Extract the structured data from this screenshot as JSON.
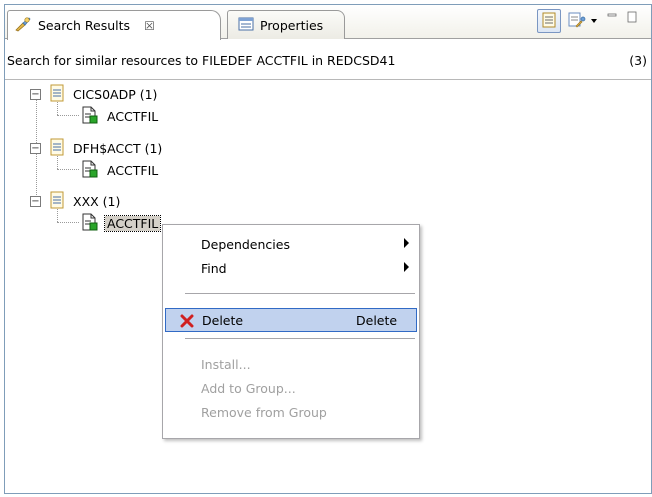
{
  "tabs": [
    {
      "label": "Search Results",
      "close": "☒"
    },
    {
      "label": "Properties"
    }
  ],
  "header": {
    "description": "Search for similar resources to FILEDEF ACCTFIL in REDCSD41",
    "count": "(3)"
  },
  "tree": [
    {
      "group": "CICS0ADP (1)",
      "child": "ACCTFIL"
    },
    {
      "group": "DFH$ACCT (1)",
      "child": "ACCTFIL"
    },
    {
      "group": "XXX (1)",
      "child": "ACCTFIL"
    }
  ],
  "context_menu": {
    "dependencies": "Dependencies",
    "find": "Find",
    "delete": "Delete",
    "delete_accel": "Delete",
    "install": "Install...",
    "add_to_group": "Add to Group...",
    "remove_from_group": "Remove from Group"
  },
  "colors": {
    "highlight": "#c1d2ee",
    "disabled_text": "#a0a0a0",
    "frame_border": "#7f9db9"
  }
}
